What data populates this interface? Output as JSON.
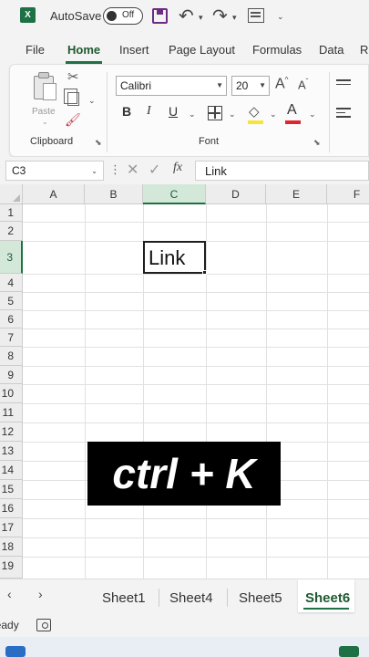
{
  "titlebar": {
    "logo": "X",
    "autosave_label": "AutoSave",
    "autosave_state": "Off",
    "icons": [
      "save-icon",
      "undo-icon",
      "redo-icon",
      "form-icon"
    ]
  },
  "ribbon_tabs": [
    "File",
    "Home",
    "Insert",
    "Page Layout",
    "Formulas",
    "Data"
  ],
  "ribbon": {
    "clipboard": {
      "paste_label": "Paste",
      "group_label": "Clipboard"
    },
    "font": {
      "font_name": "Calibri",
      "font_size": "20",
      "group_label": "Font",
      "bold": "B",
      "italic": "I",
      "underline": "U",
      "grow": "A",
      "shrink": "A",
      "font_color_letter": "A",
      "fill_color": "#f7e33b",
      "font_color": "#e0252f"
    }
  },
  "formula_bar": {
    "name_box": "C3",
    "fx": "fx",
    "content": "Link"
  },
  "grid": {
    "columns": [
      "A",
      "B",
      "C",
      "D",
      "E",
      "F"
    ],
    "rows": [
      "1",
      "2",
      "3",
      "4",
      "5",
      "6",
      "7",
      "8",
      "9",
      "10",
      "11",
      "12",
      "13",
      "14",
      "15",
      "16",
      "17",
      "18",
      "19"
    ],
    "selected_column": "C",
    "selected_row": "3",
    "active_cell_value": "Link"
  },
  "overlay_text": "ctrl + K",
  "sheet_tabs": [
    "Sheet1",
    "Sheet4",
    "Sheet5",
    "Sheet6"
  ],
  "active_sheet": "Sheet6",
  "status": {
    "text": "Ready"
  },
  "colors": {
    "accent": "#1e7145",
    "selected_header": "#d3e8d9"
  }
}
